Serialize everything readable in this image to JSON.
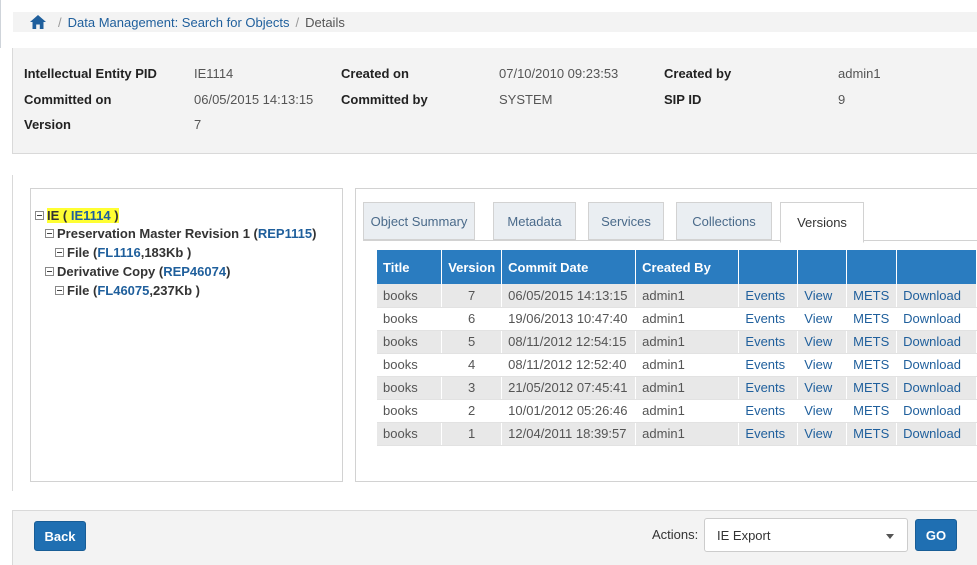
{
  "breadcrumb": {
    "home_icon": "home-icon",
    "link": "Data Management: Search for Objects",
    "current": "Details",
    "separator": "/"
  },
  "info": {
    "ie_pid_label": "Intellectual Entity PID",
    "ie_pid_value": "IE1114",
    "created_on_label": "Created on",
    "created_on_value": "07/10/2010 09:23:53",
    "created_by_label": "Created by",
    "created_by_value": "admin1",
    "committed_on_label": "Committed on",
    "committed_on_value": "06/05/2015 14:13:15",
    "committed_by_label": "Committed by",
    "committed_by_value": "SYSTEM",
    "sip_id_label": "SIP ID",
    "sip_id_value": "9",
    "version_label": "Version",
    "version_value": "7"
  },
  "tree": {
    "root_prefix": "IE ( ",
    "root_link": "IE1114",
    "root_suffix": " )",
    "rep1_prefix": "Preservation Master Revision 1 ( ",
    "rep1_link": "REP1115",
    "rep1_suffix": " )",
    "file1_prefix": "File ( ",
    "file1_link": "FL1116",
    "file1_suffix": " ,183Kb )",
    "rep2_prefix": "Derivative Copy ( ",
    "rep2_link": "REP46074",
    "rep2_suffix": " )",
    "file2_prefix": "File ( ",
    "file2_link": "FL46075",
    "file2_suffix": " ,237Kb )"
  },
  "tabs": [
    "Object Summary",
    "Metadata",
    "Services",
    "Collections",
    "Versions"
  ],
  "table": {
    "headers": [
      "Title",
      "Version",
      "Commit Date",
      "Created By",
      "",
      "",
      "",
      ""
    ],
    "rows": [
      [
        "books",
        "7",
        "06/05/2015 14:13:15",
        "admin1",
        "Events",
        "View",
        "METS",
        "Download"
      ],
      [
        "books",
        "6",
        "19/06/2013 10:47:40",
        "admin1",
        "Events",
        "View",
        "METS",
        "Download"
      ],
      [
        "books",
        "5",
        "08/11/2012 12:54:15",
        "admin1",
        "Events",
        "View",
        "METS",
        "Download"
      ],
      [
        "books",
        "4",
        "08/11/2012 12:52:40",
        "admin1",
        "Events",
        "View",
        "METS",
        "Download"
      ],
      [
        "books",
        "3",
        "21/05/2012 07:45:41",
        "admin1",
        "Events",
        "View",
        "METS",
        "Download"
      ],
      [
        "books",
        "2",
        "10/01/2012 05:26:46",
        "admin1",
        "Events",
        "View",
        "METS",
        "Download"
      ],
      [
        "books",
        "1",
        "12/04/2011 18:39:57",
        "admin1",
        "Events",
        "View",
        "METS",
        "Download"
      ]
    ]
  },
  "footer": {
    "back_label": "Back",
    "actions_label": "Actions:",
    "select_value": "IE Export",
    "go_label": "GO"
  },
  "colors": {
    "accent": "#2a7cc0",
    "link": "#1f5f9c",
    "highlight": "#ffff33"
  }
}
